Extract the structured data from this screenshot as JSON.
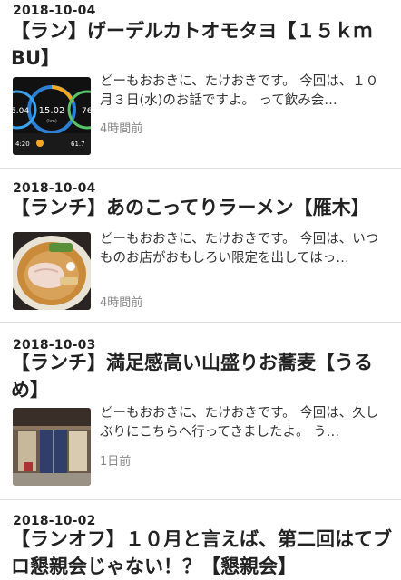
{
  "articles": [
    {
      "date": "2018-10-04",
      "title": "【ラン】げーデルカトオモタヨ【１５ｋｍBU】",
      "excerpt": "どーもおおきに、たけおきです。 今回は、１０月３日(水)のお話ですよ。 って飲み会…",
      "time": "4時間前",
      "thumb": {
        "kind": "watch",
        "center_value": "15.02",
        "left_value": "5.04",
        "right_value": "76",
        "bottom_left": "4:20",
        "bottom_right": "61.7"
      }
    },
    {
      "date": "2018-10-04",
      "title": "【ランチ】あのこってりラーメン【雁木】",
      "excerpt": "どーもおおきに、たけおきです。 今回は、いつものお店がおもしろい限定を出してはっ…",
      "time": "4時間前",
      "thumb": {
        "kind": "ramen"
      }
    },
    {
      "date": "2018-10-03",
      "title": "【ランチ】満足感高い山盛りお蕎麦【うるめ】",
      "excerpt": "どーもおおきに、たけおきです。 今回は、久しぶりにこちらへ行ってきましたよ。 う…",
      "time": "1日前",
      "thumb": {
        "kind": "storefront"
      }
    },
    {
      "date": "2018-10-02",
      "title": "【ランオフ】１０月と言えば、第二回はてブロ懇親会じゃない！？【懇親会】"
    }
  ]
}
